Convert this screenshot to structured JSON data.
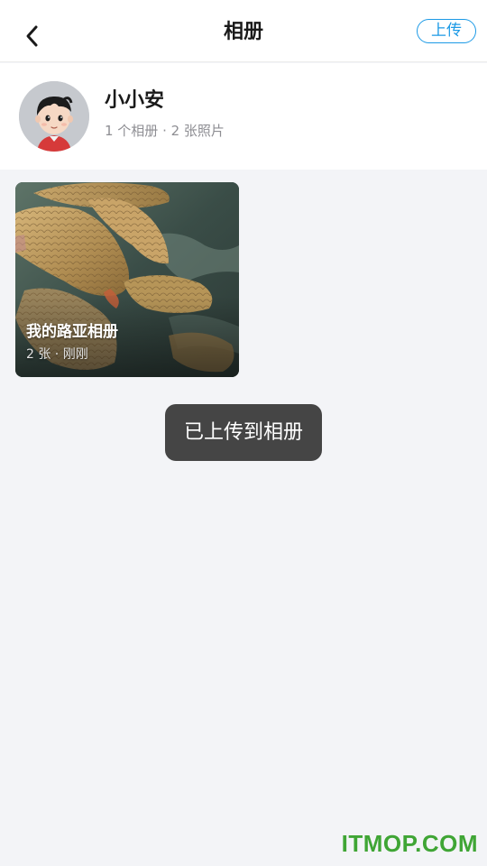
{
  "header": {
    "title": "相册",
    "upload_label": "上传",
    "back_icon": "chevron-left-icon"
  },
  "profile": {
    "username": "小小安",
    "stats": "1 个相册 · 2 张照片"
  },
  "albums": [
    {
      "name": "我的路亚相册",
      "meta": "2 张 · 刚刚"
    }
  ],
  "toast": {
    "message": "已上传到相册"
  },
  "watermark": {
    "text": "ITMOP.COM"
  },
  "colors": {
    "accent": "#1c9ae6",
    "background": "#f3f4f7",
    "toast_bg": "#373737",
    "watermark": "#3fa535"
  }
}
